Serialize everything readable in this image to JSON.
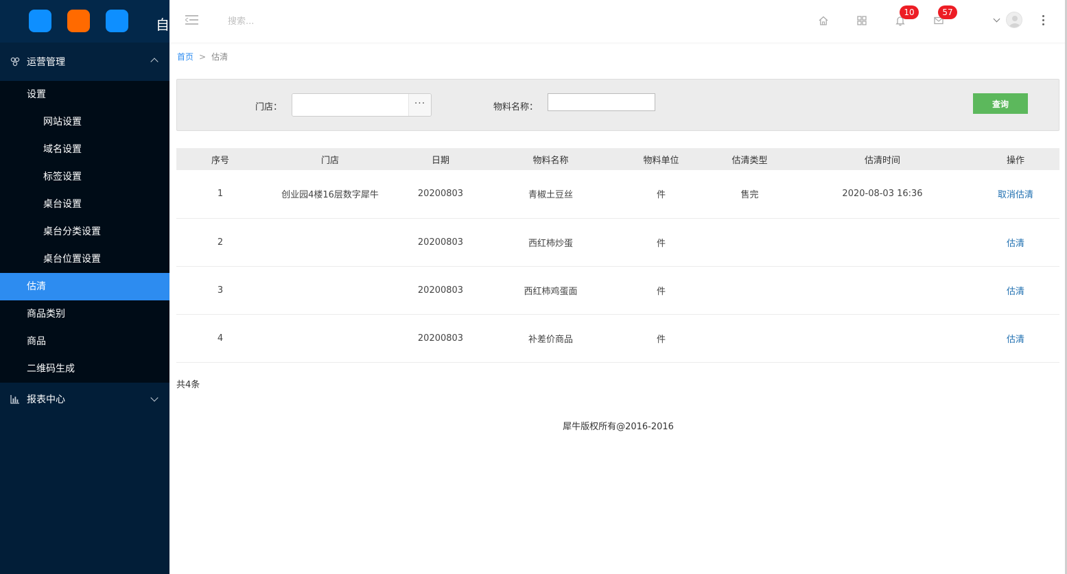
{
  "logo": {
    "text": "自",
    "dots": [
      "#0e8fff",
      "#ff6a00",
      "#0e8fff"
    ]
  },
  "sidebar": {
    "group1": {
      "label": "运营管理",
      "icon": "cluster-icon"
    },
    "settings_label": "设置",
    "sub_items": [
      "网站设置",
      "域名设置",
      "标签设置",
      "桌台设置",
      "桌台分类设置",
      "桌台位置设置"
    ],
    "items": [
      "估清",
      "商品类别",
      "商品",
      "二维码生成"
    ],
    "active_item": "估清",
    "group2": {
      "label": "报表中心",
      "icon": "bar-chart-icon"
    }
  },
  "header": {
    "search_placeholder": "搜索...",
    "icons": [
      "home-icon",
      "grid-icon",
      "bell-icon",
      "mail-icon"
    ],
    "notifications_count": "10",
    "messages_count": "57"
  },
  "breadcrumb": {
    "home": "首页",
    "sep": ">",
    "current": "估清"
  },
  "filter": {
    "store_label": "门店：",
    "store_value": "",
    "more_label": "···",
    "name_label": "物料名称：",
    "name_value": "",
    "query_label": "查询"
  },
  "table": {
    "headers": [
      "序号",
      "门店",
      "日期",
      "物料名称",
      "物料单位",
      "估清类型",
      "估清时间",
      "操作"
    ],
    "rows": [
      [
        "1",
        "创业园4楼16层数字犀牛",
        "20200803",
        "青椒土豆丝",
        "件",
        "售完",
        "2020-08-03 16:36",
        "取消估清"
      ],
      [
        "2",
        "",
        "20200803",
        "西红柿炒蛋",
        "件",
        "",
        "",
        "估清"
      ],
      [
        "3",
        "",
        "20200803",
        "西红柿鸡蛋面",
        "件",
        "",
        "",
        "估清"
      ],
      [
        "4",
        "",
        "20200803",
        "补差价商品",
        "件",
        "",
        "",
        "估清"
      ]
    ]
  },
  "total": "共4条",
  "footer": "犀牛版权所有@2016-2016",
  "colors": {
    "sidebar_bg": "#021e38",
    "active": "#2d8cf0",
    "query": "#5cb85c",
    "badge": "#ed1c24",
    "link": "#1f6fb0"
  }
}
